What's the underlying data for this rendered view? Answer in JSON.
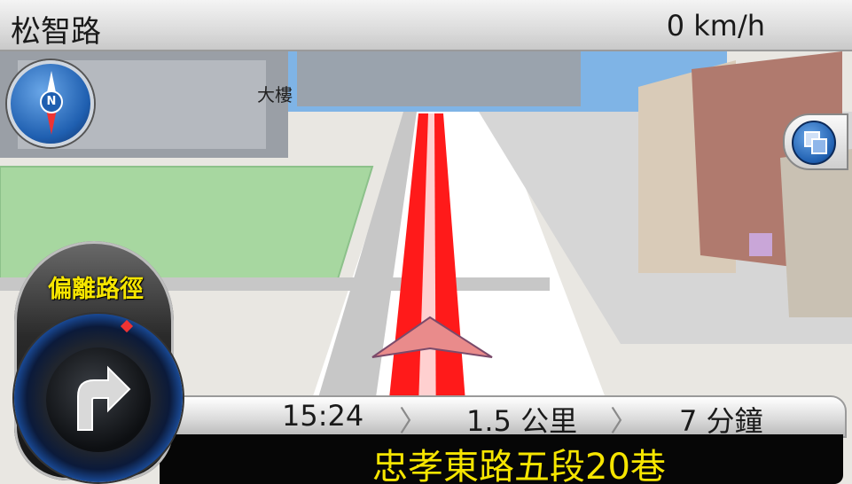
{
  "top_bar": {
    "current_street": "松智路",
    "speed": "0 km/h"
  },
  "map": {
    "poi_label": "大樓",
    "colors": {
      "route": "#ff1a1a",
      "park": "#a7d7a0",
      "sky": "#7fb4e6",
      "ground": "#e9e7e2",
      "road": "#c7c7c7"
    }
  },
  "compass": {
    "letter": "N",
    "icon": "compass-icon"
  },
  "view_toggle": {
    "icon": "view-toggle-icon"
  },
  "turn_panel": {
    "status": "偏離路徑",
    "icon": "turn-right-arrow-icon"
  },
  "info_bar": {
    "eta": "15:24",
    "distance": "1.5 公里",
    "remaining_time": "7 分鐘",
    "separator": "〉"
  },
  "next_road": "忠孝東路五段20巷"
}
